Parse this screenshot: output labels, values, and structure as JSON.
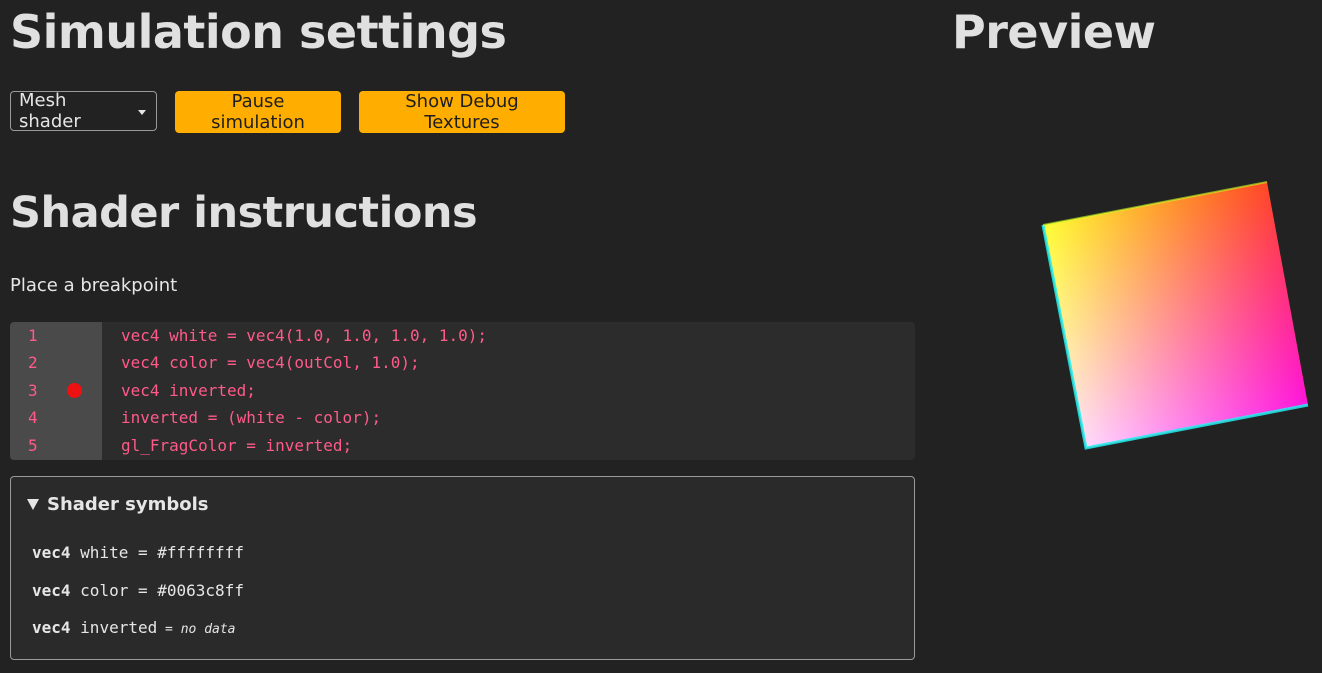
{
  "settings": {
    "title": "Simulation settings",
    "shader_select": "Mesh shader",
    "pause_label": "Pause simulation",
    "debug_label": "Show Debug Textures"
  },
  "preview": {
    "title": "Preview"
  },
  "shader": {
    "title": "Shader instructions",
    "hint": "Place a breakpoint",
    "lines": [
      {
        "num": "1",
        "code": "vec4 white = vec4(1.0, 1.0, 1.0, 1.0);",
        "breakpoint": false
      },
      {
        "num": "2",
        "code": "vec4 color = vec4(outCol, 1.0);",
        "breakpoint": false
      },
      {
        "num": "3",
        "code": "vec4 inverted;",
        "breakpoint": true
      },
      {
        "num": "4",
        "code": "inverted = (white - color);",
        "breakpoint": false
      },
      {
        "num": "5",
        "code": "gl_FragColor = inverted;",
        "breakpoint": false
      }
    ]
  },
  "symbols": {
    "summary": "Shader symbols",
    "items": [
      {
        "type": "vec4",
        "name": "white",
        "eq": " = ",
        "value": "#ffffffff",
        "no_data": ""
      },
      {
        "type": "vec4",
        "name": "color",
        "eq": " = ",
        "value": "#0063c8ff",
        "no_data": ""
      },
      {
        "type": "vec4",
        "name": "inverted",
        "eq": "",
        "value": "",
        "no_data": " = no data"
      }
    ]
  },
  "colors": {
    "accent": "#ffae00",
    "background": "#222222",
    "code_text": "#ff5a8a",
    "breakpoint": "#ee1111"
  }
}
